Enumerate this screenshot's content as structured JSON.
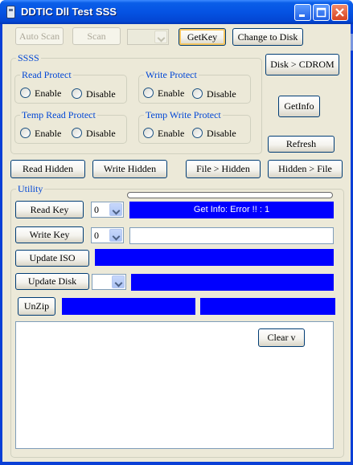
{
  "window": {
    "title": "DDTIC Dll Test SSS"
  },
  "toolbar": {
    "auto_scan": "Auto Scan",
    "scan": "Scan",
    "device_select_value": "",
    "get_key": "GetKey",
    "change_to_disk": "Change to Disk"
  },
  "sss_group": {
    "label": "SSSS",
    "read_protect": {
      "label": "Read Protect",
      "enable": "Enable",
      "disable": "Disable"
    },
    "write_protect": {
      "label": "Write Protect",
      "enable": "Enable",
      "disable": "Disable"
    },
    "temp_read_protect": {
      "label": "Temp Read Protect",
      "enable": "Enable",
      "disable": "Disable"
    },
    "temp_write_protect": {
      "label": "Temp Write Protect",
      "enable": "Enable",
      "disable": "Disable"
    }
  },
  "side_buttons": {
    "disk_to_cdrom": "Disk > CDROM",
    "get_info": "GetInfo",
    "refresh": "Refresh"
  },
  "hidden_row": {
    "read_hidden": "Read Hidden",
    "write_hidden": "Write Hidden",
    "file_to_hidden": "File > Hidden",
    "hidden_to_file": "Hidden > File"
  },
  "utility": {
    "label": "Utility",
    "read_key": "Read Key",
    "read_key_index": "0",
    "status": "Get Info: Error !! : 1",
    "write_key": "Write Key",
    "write_key_index": "0",
    "write_key_value": "",
    "update_iso": "Update ISO",
    "update_disk": "Update Disk",
    "update_disk_value": "",
    "unzip": "UnZip",
    "clear": "Clear v",
    "log_text": ""
  },
  "colors": {
    "title_bar": "#0553e3",
    "face": "#ece9d8",
    "status_bar": "#0000ff",
    "group_label": "#0046d5"
  },
  "icons": {
    "app": "disk-app-icon",
    "minimize": "minimize-icon",
    "maximize": "maximize-icon",
    "close": "close-icon"
  }
}
